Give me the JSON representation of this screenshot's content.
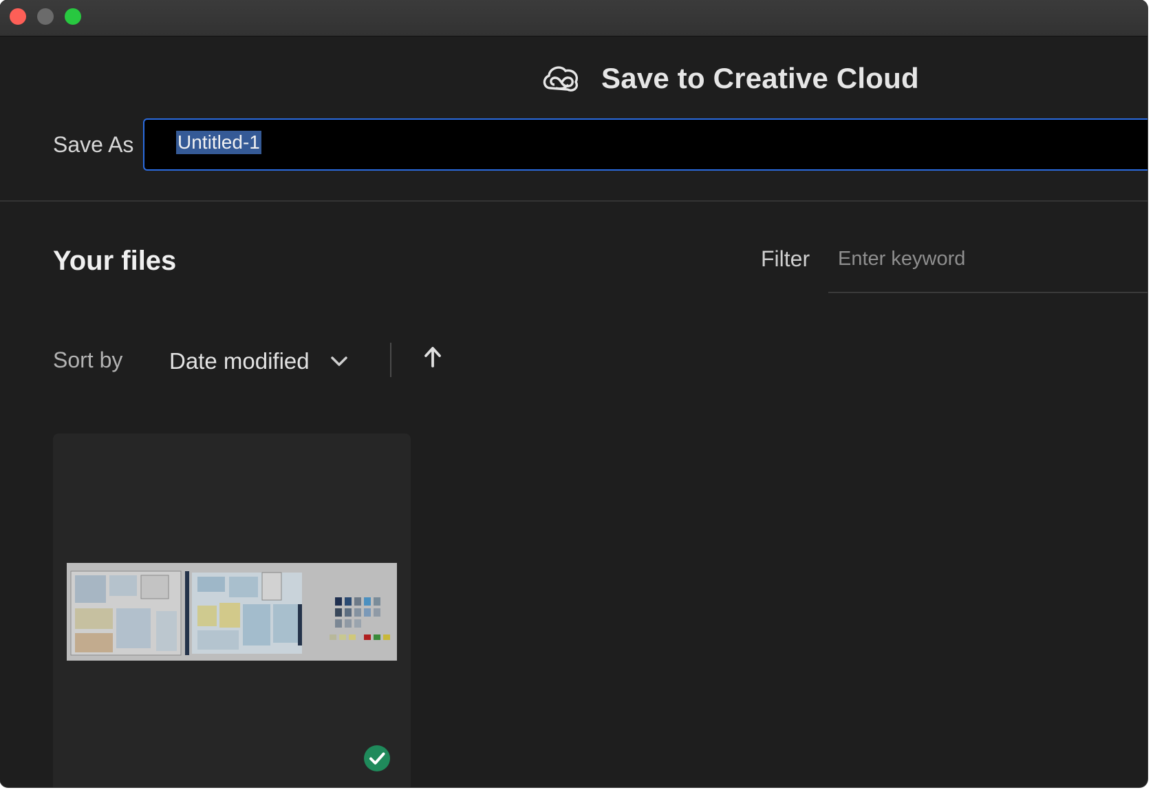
{
  "dialog": {
    "title": "Save to Creative Cloud"
  },
  "save_as": {
    "label": "Save As",
    "value": "Untitled-1"
  },
  "files": {
    "heading": "Your files",
    "filter": {
      "label": "Filter",
      "placeholder": "Enter keyword"
    },
    "sort": {
      "label": "Sort by",
      "value": "Date modified",
      "direction": "ascending"
    },
    "items": [
      {
        "synced": true
      }
    ]
  },
  "colors": {
    "window_bg": "#1e1e1e",
    "accent_blue": "#2b6ce0",
    "selection": "#355a96",
    "sync_green": "#1f8a5b"
  },
  "icons": [
    "close-icon",
    "minimize-icon",
    "maximize-icon",
    "creative-cloud-logo-icon",
    "chevron-down-icon",
    "arrow-up-icon",
    "checkmark-circle-icon"
  ]
}
